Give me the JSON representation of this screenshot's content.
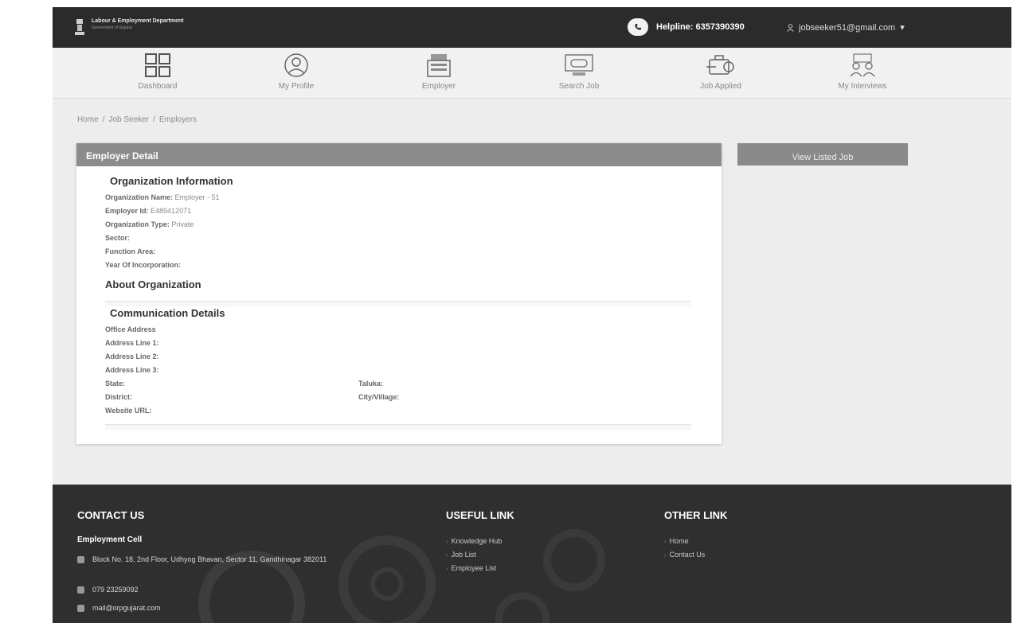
{
  "header": {
    "dept_name": "Labour & Employment Department",
    "gov_name": "Government of Gujarat",
    "helpline": "Helpline: 6357390390",
    "user_email": "jobseeker51@gmail.com",
    "user_caret": "▾"
  },
  "nav": {
    "items": [
      {
        "label": "Dashboard",
        "icon": "dashboard-grid-icon"
      },
      {
        "label": "My Profile",
        "icon": "user-profile-icon"
      },
      {
        "label": "Employer",
        "icon": "building-icon"
      },
      {
        "label": "Search Job",
        "icon": "search-job-monitor-icon"
      },
      {
        "label": "Job Applied",
        "icon": "briefcase-arrow-icon"
      },
      {
        "label": "My Interviews",
        "icon": "interview-people-icon"
      }
    ]
  },
  "breadcrumb": [
    "Home",
    "Job Seeker",
    "Employers"
  ],
  "breadcrumb_sep": "/",
  "card": {
    "title": "Employer Detail",
    "org_info_title": "Organization Information",
    "org_fields": [
      {
        "label": "Organization Name:",
        "value": "Employer - 51"
      },
      {
        "label": "Employer Id:",
        "value": "E489412071"
      },
      {
        "label": "Organization Type:",
        "value": "Private"
      },
      {
        "label": "Sector:",
        "value": ""
      },
      {
        "label": "Function Area:",
        "value": ""
      },
      {
        "label": "Year Of Incorporation:",
        "value": ""
      }
    ],
    "about_title": "About Organization",
    "comm_title": "Communication Details",
    "office_address": "Office Address",
    "address_lines": [
      "Address Line 1:",
      "Address Line 2:",
      "Address Line 3:"
    ],
    "state_label": "State:",
    "taluka_label": "Taluka:",
    "district_label": "District:",
    "city_label": "City/Village:",
    "website_label": "Website URL:"
  },
  "view_listed_job": "View Listed Job",
  "footer": {
    "contact_title": "CONTACT US",
    "cell_name": "Employment Cell",
    "address": "Block No. 18, 2nd Floor, Udhyog Bhavan, Sector 11, Gandhinagar 382011",
    "phone": "079 23259092",
    "email": "mail@orpgujarat.com",
    "useful_title": "USEFUL LINK",
    "useful_links": [
      "Knowledge Hub",
      "Job List",
      "Employee List"
    ],
    "other_title": "OTHER LINK",
    "other_links": [
      "Home",
      "Contact Us"
    ]
  },
  "colors": {
    "topbar": "#2b2b2b",
    "navbar": "#f1f1f1",
    "card_header": "#8c8c8c",
    "footer": "#2f2f2f"
  }
}
